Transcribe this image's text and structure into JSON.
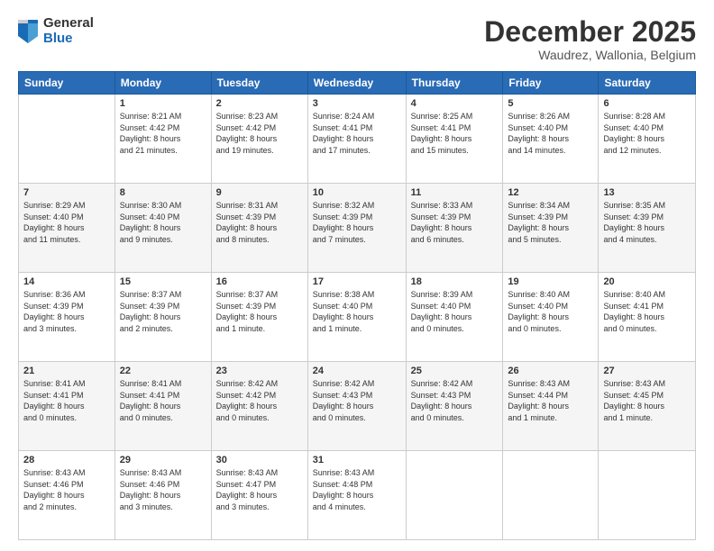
{
  "logo": {
    "general": "General",
    "blue": "Blue"
  },
  "header": {
    "title": "December 2025",
    "subtitle": "Waudrez, Wallonia, Belgium"
  },
  "days_of_week": [
    "Sunday",
    "Monday",
    "Tuesday",
    "Wednesday",
    "Thursday",
    "Friday",
    "Saturday"
  ],
  "weeks": [
    [
      {
        "day": "",
        "info": ""
      },
      {
        "day": "1",
        "info": "Sunrise: 8:21 AM\nSunset: 4:42 PM\nDaylight: 8 hours\nand 21 minutes."
      },
      {
        "day": "2",
        "info": "Sunrise: 8:23 AM\nSunset: 4:42 PM\nDaylight: 8 hours\nand 19 minutes."
      },
      {
        "day": "3",
        "info": "Sunrise: 8:24 AM\nSunset: 4:41 PM\nDaylight: 8 hours\nand 17 minutes."
      },
      {
        "day": "4",
        "info": "Sunrise: 8:25 AM\nSunset: 4:41 PM\nDaylight: 8 hours\nand 15 minutes."
      },
      {
        "day": "5",
        "info": "Sunrise: 8:26 AM\nSunset: 4:40 PM\nDaylight: 8 hours\nand 14 minutes."
      },
      {
        "day": "6",
        "info": "Sunrise: 8:28 AM\nSunset: 4:40 PM\nDaylight: 8 hours\nand 12 minutes."
      }
    ],
    [
      {
        "day": "7",
        "info": "Sunrise: 8:29 AM\nSunset: 4:40 PM\nDaylight: 8 hours\nand 11 minutes."
      },
      {
        "day": "8",
        "info": "Sunrise: 8:30 AM\nSunset: 4:40 PM\nDaylight: 8 hours\nand 9 minutes."
      },
      {
        "day": "9",
        "info": "Sunrise: 8:31 AM\nSunset: 4:39 PM\nDaylight: 8 hours\nand 8 minutes."
      },
      {
        "day": "10",
        "info": "Sunrise: 8:32 AM\nSunset: 4:39 PM\nDaylight: 8 hours\nand 7 minutes."
      },
      {
        "day": "11",
        "info": "Sunrise: 8:33 AM\nSunset: 4:39 PM\nDaylight: 8 hours\nand 6 minutes."
      },
      {
        "day": "12",
        "info": "Sunrise: 8:34 AM\nSunset: 4:39 PM\nDaylight: 8 hours\nand 5 minutes."
      },
      {
        "day": "13",
        "info": "Sunrise: 8:35 AM\nSunset: 4:39 PM\nDaylight: 8 hours\nand 4 minutes."
      }
    ],
    [
      {
        "day": "14",
        "info": "Sunrise: 8:36 AM\nSunset: 4:39 PM\nDaylight: 8 hours\nand 3 minutes."
      },
      {
        "day": "15",
        "info": "Sunrise: 8:37 AM\nSunset: 4:39 PM\nDaylight: 8 hours\nand 2 minutes."
      },
      {
        "day": "16",
        "info": "Sunrise: 8:37 AM\nSunset: 4:39 PM\nDaylight: 8 hours\nand 1 minute."
      },
      {
        "day": "17",
        "info": "Sunrise: 8:38 AM\nSunset: 4:40 PM\nDaylight: 8 hours\nand 1 minute."
      },
      {
        "day": "18",
        "info": "Sunrise: 8:39 AM\nSunset: 4:40 PM\nDaylight: 8 hours\nand 0 minutes."
      },
      {
        "day": "19",
        "info": "Sunrise: 8:40 AM\nSunset: 4:40 PM\nDaylight: 8 hours\nand 0 minutes."
      },
      {
        "day": "20",
        "info": "Sunrise: 8:40 AM\nSunset: 4:41 PM\nDaylight: 8 hours\nand 0 minutes."
      }
    ],
    [
      {
        "day": "21",
        "info": "Sunrise: 8:41 AM\nSunset: 4:41 PM\nDaylight: 8 hours\nand 0 minutes."
      },
      {
        "day": "22",
        "info": "Sunrise: 8:41 AM\nSunset: 4:41 PM\nDaylight: 8 hours\nand 0 minutes."
      },
      {
        "day": "23",
        "info": "Sunrise: 8:42 AM\nSunset: 4:42 PM\nDaylight: 8 hours\nand 0 minutes."
      },
      {
        "day": "24",
        "info": "Sunrise: 8:42 AM\nSunset: 4:43 PM\nDaylight: 8 hours\nand 0 minutes."
      },
      {
        "day": "25",
        "info": "Sunrise: 8:42 AM\nSunset: 4:43 PM\nDaylight: 8 hours\nand 0 minutes."
      },
      {
        "day": "26",
        "info": "Sunrise: 8:43 AM\nSunset: 4:44 PM\nDaylight: 8 hours\nand 1 minute."
      },
      {
        "day": "27",
        "info": "Sunrise: 8:43 AM\nSunset: 4:45 PM\nDaylight: 8 hours\nand 1 minute."
      }
    ],
    [
      {
        "day": "28",
        "info": "Sunrise: 8:43 AM\nSunset: 4:46 PM\nDaylight: 8 hours\nand 2 minutes."
      },
      {
        "day": "29",
        "info": "Sunrise: 8:43 AM\nSunset: 4:46 PM\nDaylight: 8 hours\nand 3 minutes."
      },
      {
        "day": "30",
        "info": "Sunrise: 8:43 AM\nSunset: 4:47 PM\nDaylight: 8 hours\nand 3 minutes."
      },
      {
        "day": "31",
        "info": "Sunrise: 8:43 AM\nSunset: 4:48 PM\nDaylight: 8 hours\nand 4 minutes."
      },
      {
        "day": "",
        "info": ""
      },
      {
        "day": "",
        "info": ""
      },
      {
        "day": "",
        "info": ""
      }
    ]
  ]
}
